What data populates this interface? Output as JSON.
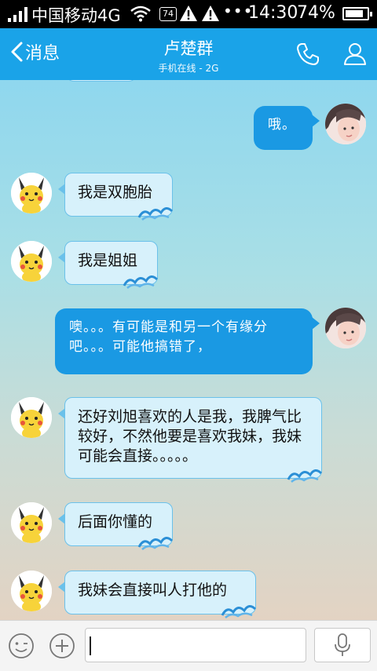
{
  "status_bar": {
    "carrier": "中国移动4G",
    "notification_badge": "74",
    "time": "14:30",
    "battery_percent": "74%",
    "battery_level": 0.74
  },
  "header": {
    "back_label": "消息",
    "title": "卢楚群",
    "subtitle": "手机在线 - 2G"
  },
  "colors": {
    "header_bg": "#1aa3e8",
    "sent_bubble": "#1a99e3",
    "recv_bubble": "#d7f1fb"
  },
  "messages": [
    {
      "side": "sent",
      "text": "哦。"
    },
    {
      "side": "received",
      "text": "我是双胞胎"
    },
    {
      "side": "received",
      "text": "我是姐姐"
    },
    {
      "side": "sent",
      "text": "噢。。。有可能是和另一个有缘分吧。。。可能他搞错了，"
    },
    {
      "side": "received",
      "text": "还好刘旭喜欢的人是我，我脾气比较好，不然他要是喜欢我妹，我妹可能会直接。。。。。"
    },
    {
      "side": "received",
      "text": "后面你懂的"
    },
    {
      "side": "received",
      "text": "我妹会直接叫人打他的"
    }
  ],
  "input_bar": {
    "text_value": "",
    "icons": [
      "emoji-icon",
      "plus-icon",
      "microphone-icon"
    ]
  }
}
